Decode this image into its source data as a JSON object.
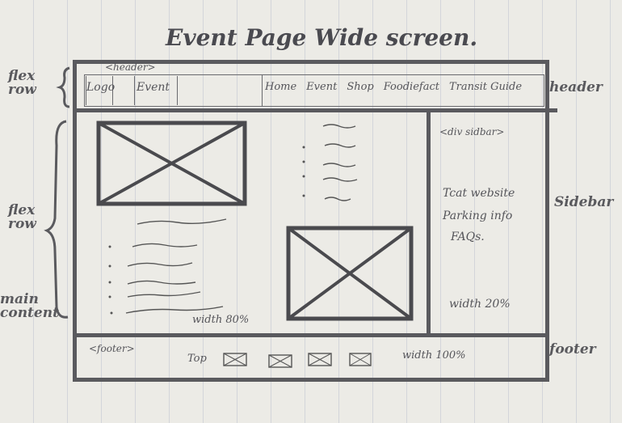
{
  "title": "Event Page Wide screen.",
  "annotations": {
    "header_row": "flex row",
    "main_row": "flex row",
    "main_content": "main content",
    "header": "header",
    "sidebar": "Sidebar",
    "footer": "footer"
  },
  "header": {
    "tag": "<header>",
    "logo": "Logo",
    "event": "Event",
    "nav": [
      "Home",
      "Event",
      "Shop",
      "Foodiefact",
      "Transit Guide"
    ]
  },
  "main": {
    "width_note": "width 80%"
  },
  "sidebar": {
    "tag": "<div sidbar>",
    "lines": [
      "Tcat website",
      "Parking info",
      "FAQs."
    ],
    "width_note": "width 20%"
  },
  "footer": {
    "tag": "<footer>",
    "top_link": "Top",
    "icons": [
      "image-placeholder",
      "image-placeholder",
      "image-placeholder",
      "image-placeholder"
    ],
    "width_note": "width 100%"
  }
}
